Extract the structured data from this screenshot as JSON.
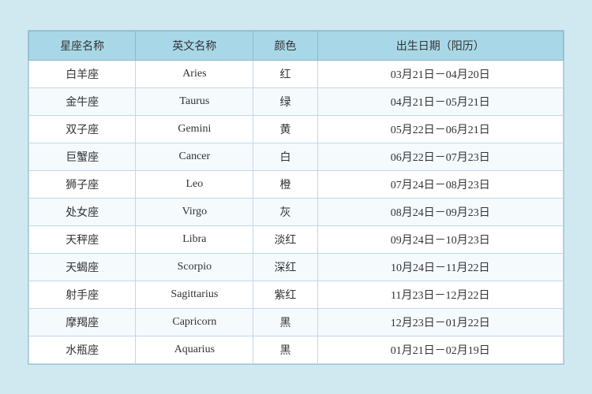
{
  "table": {
    "headers": [
      "星座名称",
      "英文名称",
      "颜色",
      "出生日期（阳历）"
    ],
    "rows": [
      {
        "chinese": "白羊座",
        "english": "Aries",
        "color": "红",
        "date": "03月21日－04月20日"
      },
      {
        "chinese": "金牛座",
        "english": "Taurus",
        "color": "绿",
        "date": "04月21日－05月21日"
      },
      {
        "chinese": "双子座",
        "english": "Gemini",
        "color": "黄",
        "date": "05月22日－06月21日"
      },
      {
        "chinese": "巨蟹座",
        "english": "Cancer",
        "color": "白",
        "date": "06月22日－07月23日"
      },
      {
        "chinese": "狮子座",
        "english": "Leo",
        "color": "橙",
        "date": "07月24日－08月23日"
      },
      {
        "chinese": "处女座",
        "english": "Virgo",
        "color": "灰",
        "date": "08月24日－09月23日"
      },
      {
        "chinese": "天秤座",
        "english": "Libra",
        "color": "淡红",
        "date": "09月24日－10月23日"
      },
      {
        "chinese": "天蝎座",
        "english": "Scorpio",
        "color": "深红",
        "date": "10月24日－11月22日"
      },
      {
        "chinese": "射手座",
        "english": "Sagittarius",
        "color": "紫红",
        "date": "11月23日－12月22日"
      },
      {
        "chinese": "摩羯座",
        "english": "Capricorn",
        "color": "黑",
        "date": "12月23日－01月22日"
      },
      {
        "chinese": "水瓶座",
        "english": "Aquarius",
        "color": "黑",
        "date": "01月21日－02月19日"
      }
    ]
  }
}
